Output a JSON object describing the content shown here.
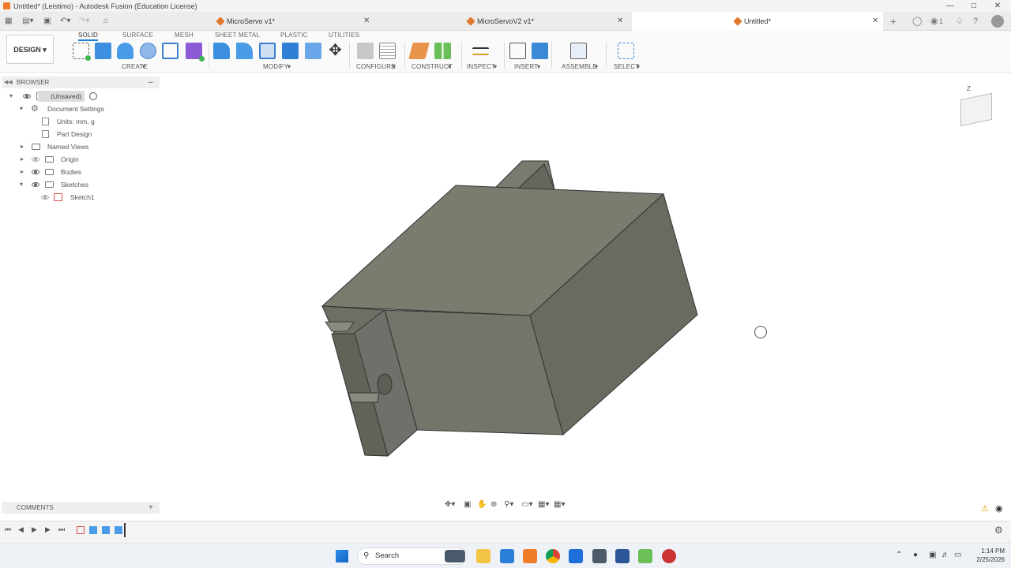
{
  "window": {
    "title": "Untitled* (Leistimo) - Autodesk Fusion (Education License)"
  },
  "tabs": [
    {
      "label": "MicroServo v1*"
    },
    {
      "label": "MicroServoV2 v1*"
    },
    {
      "label": "Untitled*"
    }
  ],
  "header_right": {
    "jobs_count": "1"
  },
  "toolbar": {
    "workspace": "DESIGN",
    "workspace_tabs": [
      "SOLID",
      "SURFACE",
      "MESH",
      "SHEET METAL",
      "PLASTIC",
      "UTILITIES"
    ],
    "groups": [
      "CREATE",
      "MODIFY",
      "CONFIGURE",
      "CONSTRUCT",
      "INSPECT",
      "INSERT",
      "ASSEMBLE",
      "SELECT"
    ]
  },
  "browser": {
    "title": "BROWSER",
    "items": [
      {
        "label": "(Unsaved)"
      },
      {
        "label": "Document Settings"
      },
      {
        "label": "Units: mm, g"
      },
      {
        "label": "Part Design"
      },
      {
        "label": "Named Views"
      },
      {
        "label": "Origin"
      },
      {
        "label": "Bodies"
      },
      {
        "label": "Sketches"
      },
      {
        "label": "Sketch1"
      }
    ]
  },
  "viewcube": {
    "axis_label": "Z"
  },
  "comments": {
    "title": "COMMENTS"
  },
  "taskbar": {
    "search_placeholder": "Search",
    "time": "1:14 PM",
    "date": "2/25/2026"
  },
  "colors": {
    "accent": "#1f7fd0",
    "body_top": "#7b7b70",
    "body_front": "#74746a",
    "body_side": "#6a6a60",
    "fusion_orange": "#f07c2a"
  }
}
